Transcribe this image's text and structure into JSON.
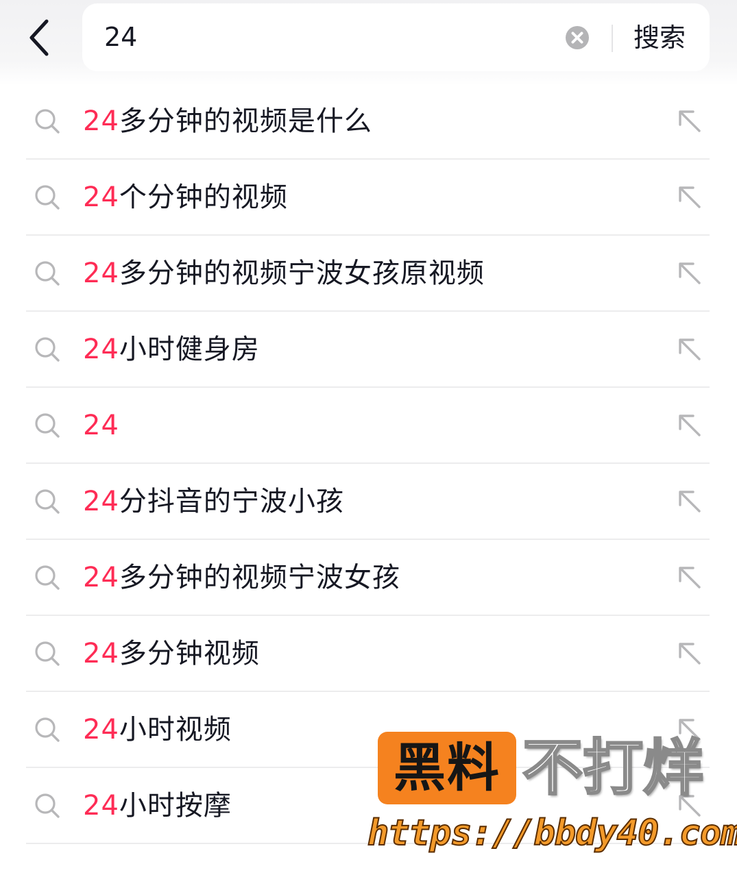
{
  "header": {
    "back_icon": "chevron-left-icon",
    "search_value": "24",
    "clear_icon": "clear-circle-icon",
    "search_button_label": "搜索"
  },
  "colors": {
    "highlight": "#fe2c55",
    "text": "#161823",
    "icon": "#b7b7b9",
    "watermark_orange": "#f5821f"
  },
  "suggestions": [
    {
      "highlight": "24",
      "rest": "多分钟的视频是什么"
    },
    {
      "highlight": "24",
      "rest": "个分钟的视频"
    },
    {
      "highlight": "24",
      "rest": "多分钟的视频宁波女孩原视频"
    },
    {
      "highlight": "24",
      "rest": "小时健身房"
    },
    {
      "highlight": "24",
      "rest": ""
    },
    {
      "highlight": "24",
      "rest": "分抖音的宁波小孩"
    },
    {
      "highlight": "24",
      "rest": "多分钟的视频宁波女孩"
    },
    {
      "highlight": "24",
      "rest": "多分钟视频"
    },
    {
      "highlight": "24",
      "rest": "小时视频"
    },
    {
      "highlight": "24",
      "rest": "小时按摩"
    }
  ],
  "suggestion_icons": {
    "leading": "search-icon",
    "trailing": "fill-query-arrow-icon"
  },
  "watermark": {
    "badge": "黑料",
    "slogan": "不打烊",
    "url": "https://bbdy40.com"
  }
}
